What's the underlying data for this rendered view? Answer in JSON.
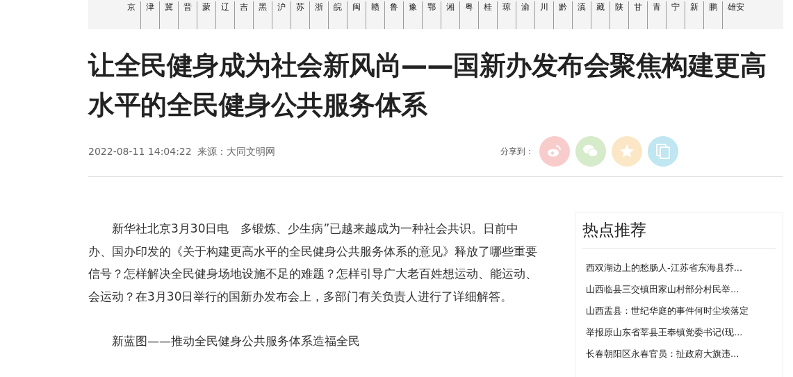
{
  "regions": [
    "京",
    "津",
    "冀",
    "晋",
    "蒙",
    "辽",
    "吉",
    "黑",
    "沪",
    "苏",
    "浙",
    "皖",
    "闽",
    "赣",
    "鲁",
    "豫",
    "鄂",
    "湘",
    "粤",
    "桂",
    "琼",
    "渝",
    "川",
    "黔",
    "滇",
    "藏",
    "陕",
    "甘",
    "青",
    "宁",
    "新",
    "鹏",
    "雄安"
  ],
  "article": {
    "title": "让全民健身成为社会新风尚——国新办发布会聚焦构建更高水平的全民健身公共服务体系",
    "datetime": "2022-08-11 14:04:22",
    "source": "来源：大同文明网",
    "share_label": "分享到：",
    "share_buttons": [
      {
        "kind": "weibo",
        "color": "#f9cccc"
      },
      {
        "kind": "wechat",
        "color": "#d5ebc9"
      },
      {
        "kind": "qzone",
        "color": "#fbe7c6"
      },
      {
        "kind": "copy",
        "color": "#bfe6f1"
      }
    ],
    "paragraphs": [
      "新华社北京3月30日电　多锻炼、少生病”已越来越成为一种社会共识。日前中办、国办印发的《关于构建更高水平的全民健身公共服务体系的意见》释放了哪些重要信号？怎样解决全民健身场地设施不足的难题？怎样引导广大老百姓想运动、能运动、会运动？在3月30日举行的国新办发布会上，多部门有关负责人进行了详细解答。",
      "新蓝图——推动全民健身公共服务体系造福全民"
    ]
  },
  "sidebar": {
    "title": "热点推荐",
    "items": [
      "西双湖边上的愁肠人-江苏省东海县乔...",
      "山西临县三交镇田家山村部分村民举...",
      "山西盂县：世纪华庭的事件何时尘埃落定",
      "举报原山东省莘县王奉镇党委书记(现...",
      "长春朝阳区永春官员：扯政府大旗违..."
    ]
  }
}
